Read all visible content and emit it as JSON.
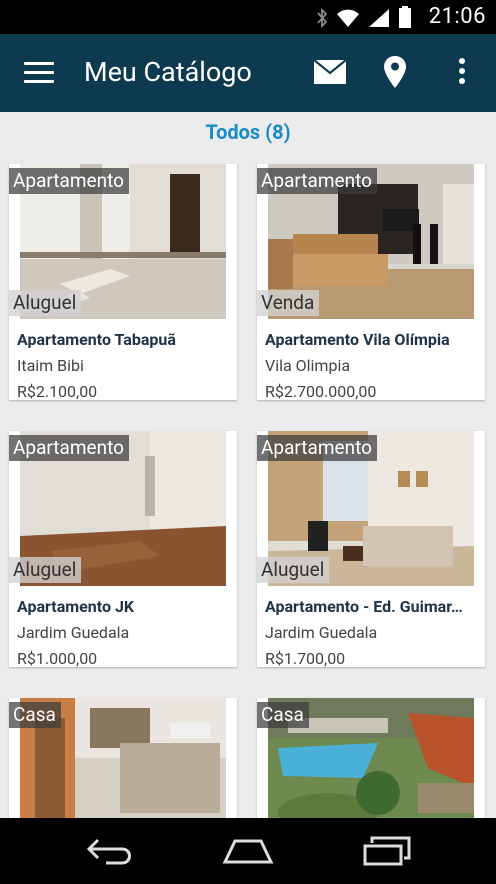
{
  "status_bar": {
    "time": "21:06"
  },
  "app_bar": {
    "title": "Meu Catálogo"
  },
  "filter": {
    "label": "Todos (8)"
  },
  "listings": [
    {
      "category": "Apartamento",
      "deal": "Aluguel",
      "name": "Apartamento Tabapuã",
      "area": "Itaim Bibi",
      "price": "R$2.100,00"
    },
    {
      "category": "Apartamento",
      "deal": "Venda",
      "name": "Apartamento Vila Olímpia",
      "area": "Vila Olimpia",
      "price": "R$2.700.000,00"
    },
    {
      "category": "Apartamento",
      "deal": "Aluguel",
      "name": "Apartamento JK",
      "area": "Jardim Guedala",
      "price": "R$1.000,00"
    },
    {
      "category": "Apartamento",
      "deal": "Aluguel",
      "name": "Apartamento - Ed. Guimar…",
      "area": "Jardim Guedala",
      "price": "R$1.700,00"
    },
    {
      "category": "Casa"
    },
    {
      "category": "Casa"
    }
  ]
}
